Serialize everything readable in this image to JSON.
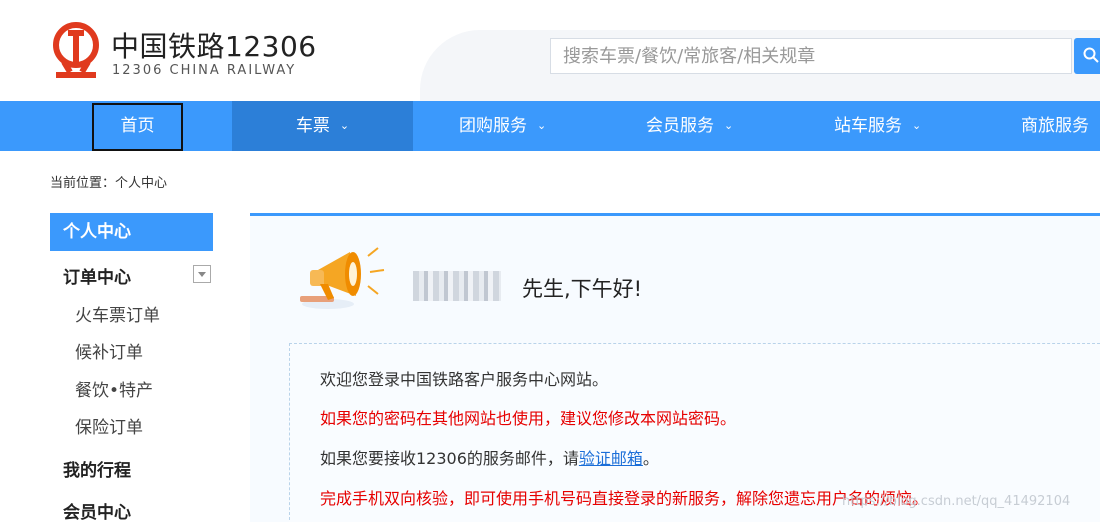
{
  "header": {
    "brand_title": "中国铁路12306",
    "brand_subtitle": "12306 CHINA RAILWAY",
    "search_placeholder": "搜索车票/餐饮/常旅客/相关规章"
  },
  "nav": {
    "items": [
      {
        "label": "首页"
      },
      {
        "label": "车票"
      },
      {
        "label": "团购服务"
      },
      {
        "label": "会员服务"
      },
      {
        "label": "站车服务"
      },
      {
        "label": "商旅服务"
      }
    ]
  },
  "breadcrumb": "当前位置：个人中心",
  "sidebar": {
    "header": "个人中心",
    "order_center": "订单中心",
    "order_items": [
      "火车票订单",
      "候补订单",
      "餐饮•特产",
      "保险订单"
    ],
    "my_trips": "我的行程",
    "member_center": "会员中心"
  },
  "main": {
    "greeting": "先生,下午好!",
    "line1": "欢迎您登录中国铁路客户服务中心网站。",
    "line2": "如果您的密码在其他网站也使用，建议您修改本网站密码。",
    "line3_prefix": "如果您要接收12306的服务邮件，请",
    "line3_link": "验证邮箱",
    "line3_suffix": "。",
    "line4": "完成手机双向核验，即可使用手机号码直接登录的新服务，解除您遗忘用户名的烦恼。"
  },
  "watermark": "https://blog.csdn.net/qq_41492104",
  "colors": {
    "brand_red": "#e03a1e",
    "nav_blue": "#3b99fc",
    "nav_active": "#2c7fd8",
    "warning_red": "#e60000",
    "link_blue": "#1a6ed8"
  }
}
